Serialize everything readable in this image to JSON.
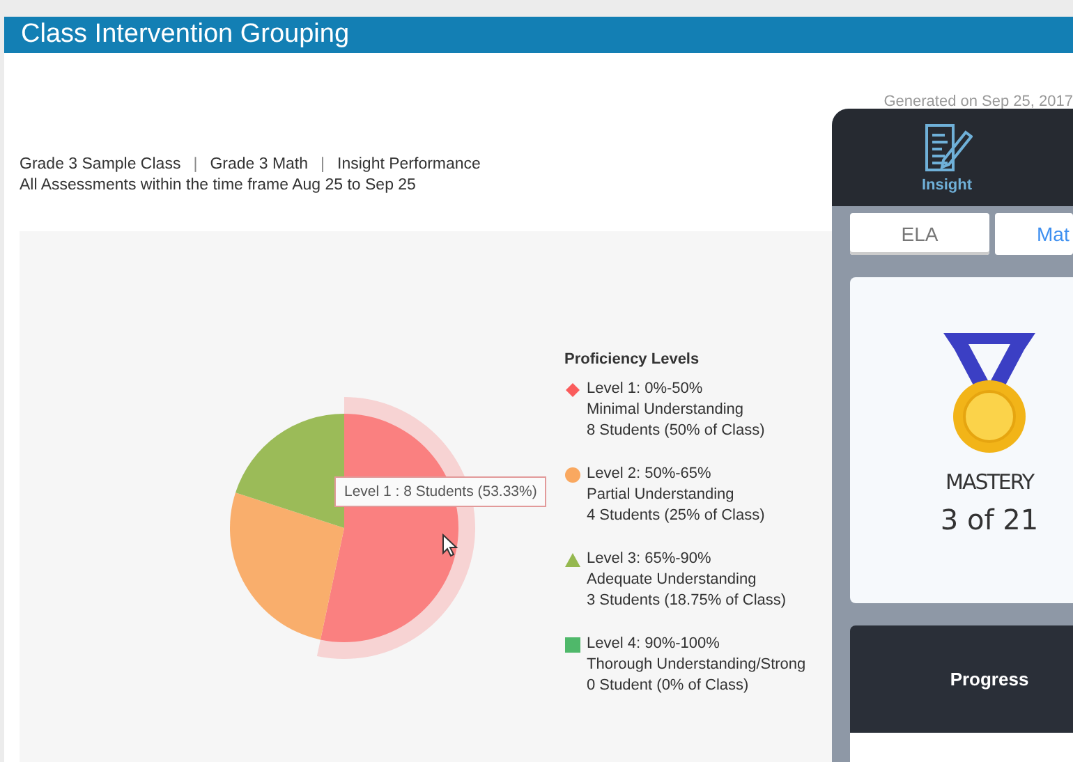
{
  "header": {
    "title": "Class Intervention Grouping"
  },
  "generated": "Generated on Sep 25, 2017",
  "breadcrumb": [
    "Grade 3 Sample Class",
    "Grade 3 Math",
    "Insight Performance"
  ],
  "breadcrumb_separator": "|",
  "timeframe": "All Assessments within the time frame Aug 25 to Sep 25",
  "chart": {
    "chart_data": {
      "type": "pie",
      "values": [
        53.33,
        26.67,
        20,
        0
      ],
      "colors": [
        "#fa8080",
        "#f9ae6c",
        "#9bbb58",
        "#4fb86a"
      ]
    },
    "tooltip": "Level 1 : 8 Students (53.33%)",
    "legend_title": "Proficiency Levels",
    "legend": [
      {
        "kind": "diamond",
        "color": "#fa5c5c",
        "hovered": true,
        "range": "Level 1: 0%-50%",
        "description": "Minimal Understanding",
        "count": "8 Students (50% of Class)"
      },
      {
        "kind": "circle",
        "color": "#f9a860",
        "hovered": false,
        "range": "Level 2: 50%-65%",
        "description": "Partial Understanding",
        "count": "4 Students (25% of Class)"
      },
      {
        "kind": "triangle",
        "color": "#95b84f",
        "hovered": false,
        "range": "Level 3: 65%-90%",
        "description": "Adequate Understanding",
        "count": "3 Students (18.75% of Class)"
      },
      {
        "kind": "square",
        "color": "#4fb86a",
        "hovered": false,
        "range": "Level 4: 90%-100%",
        "description": "Thorough Understanding/Strong",
        "count": "0 Student (0% of Class)"
      }
    ]
  },
  "panel": {
    "app_label": "Insight",
    "tabs": [
      {
        "label": "ELA",
        "selected": false
      },
      {
        "label": "Mat",
        "selected": true
      }
    ],
    "badge": {
      "title": "MASTERY",
      "value": "3 of 21"
    },
    "progress": "Progress"
  }
}
